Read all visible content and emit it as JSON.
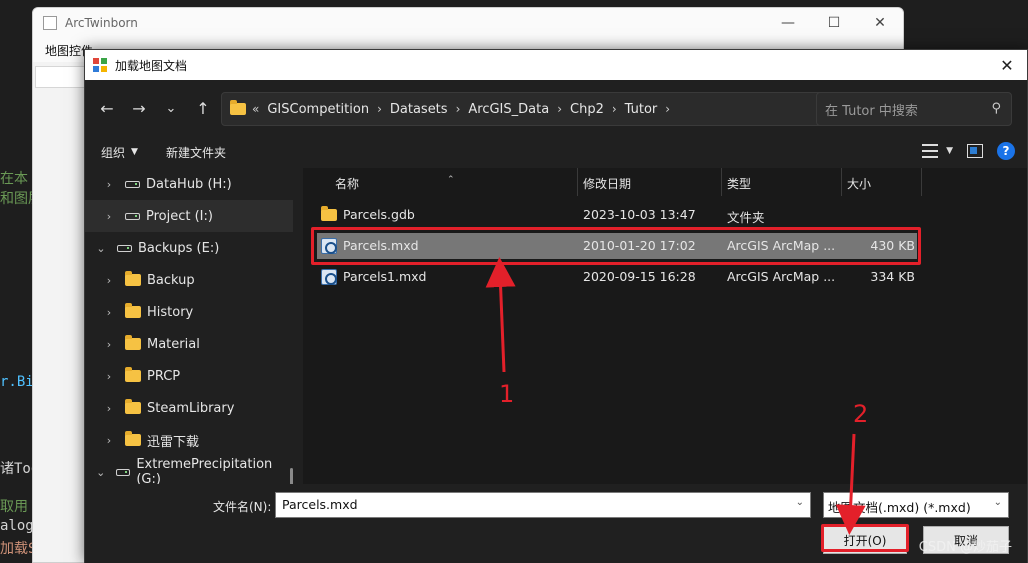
{
  "background": {
    "lines": [
      "在本",
      "和图层",
      "r.Bi",
      "诸Too",
      "取用",
      "alog",
      "加载S"
    ]
  },
  "parent_window": {
    "title": "ArcTwinborn",
    "menu_item": "地图控件",
    "controls": [
      "—",
      "☐",
      "✕"
    ]
  },
  "dialog": {
    "title": "加载地图文档",
    "close": "✕",
    "nav": {
      "back": "←",
      "forward": "→",
      "recent": "⌄",
      "up": "↑"
    },
    "breadcrumb_prefix": "«",
    "breadcrumb": [
      "GISCompetition",
      "Datasets",
      "ArcGIS_Data",
      "Chp2",
      "Tutor"
    ],
    "search_placeholder": "在 Tutor 中搜索",
    "toolbar": {
      "organize": "组织",
      "new_folder": "新建文件夹"
    },
    "tree": [
      {
        "label": "DataHub (H:)",
        "type": "drive",
        "expanded": false
      },
      {
        "label": "Project (I:)",
        "type": "drive",
        "expanded": false,
        "selected": true
      },
      {
        "label": "Backups (E:)",
        "type": "drive",
        "expanded": true
      },
      {
        "label": "Backup",
        "type": "folder"
      },
      {
        "label": "History",
        "type": "folder"
      },
      {
        "label": "Material",
        "type": "folder"
      },
      {
        "label": "PRCP",
        "type": "folder"
      },
      {
        "label": "SteamLibrary",
        "type": "folder"
      },
      {
        "label": "迅雷下载",
        "type": "folder"
      },
      {
        "label": "ExtremePrecipitation (G:)",
        "type": "drive",
        "expanded": true
      }
    ],
    "columns": [
      "名称",
      "修改日期",
      "类型",
      "大小"
    ],
    "files": [
      {
        "name": "Parcels.gdb",
        "date": "2023-10-03 13:47",
        "type": "文件夹",
        "size": "",
        "icon": "folder"
      },
      {
        "name": "Parcels.mxd",
        "date": "2010-01-20 17:02",
        "type": "ArcGIS ArcMap ...",
        "size": "430 KB",
        "icon": "mxd",
        "selected": true
      },
      {
        "name": "Parcels1.mxd",
        "date": "2020-09-15 16:28",
        "type": "ArcGIS ArcMap ...",
        "size": "334 KB",
        "icon": "mxd"
      }
    ],
    "filename_label": "文件名(N):",
    "filename_value": "Parcels.mxd",
    "filter_value": "地图文档(.mxd) (*.mxd)",
    "open_label": "打开(O)",
    "cancel_label": "取消"
  },
  "annotations": {
    "step1": "1",
    "step2": "2",
    "highlight_color": "#e3202a"
  },
  "watermark": "CSDN @炒茄子"
}
